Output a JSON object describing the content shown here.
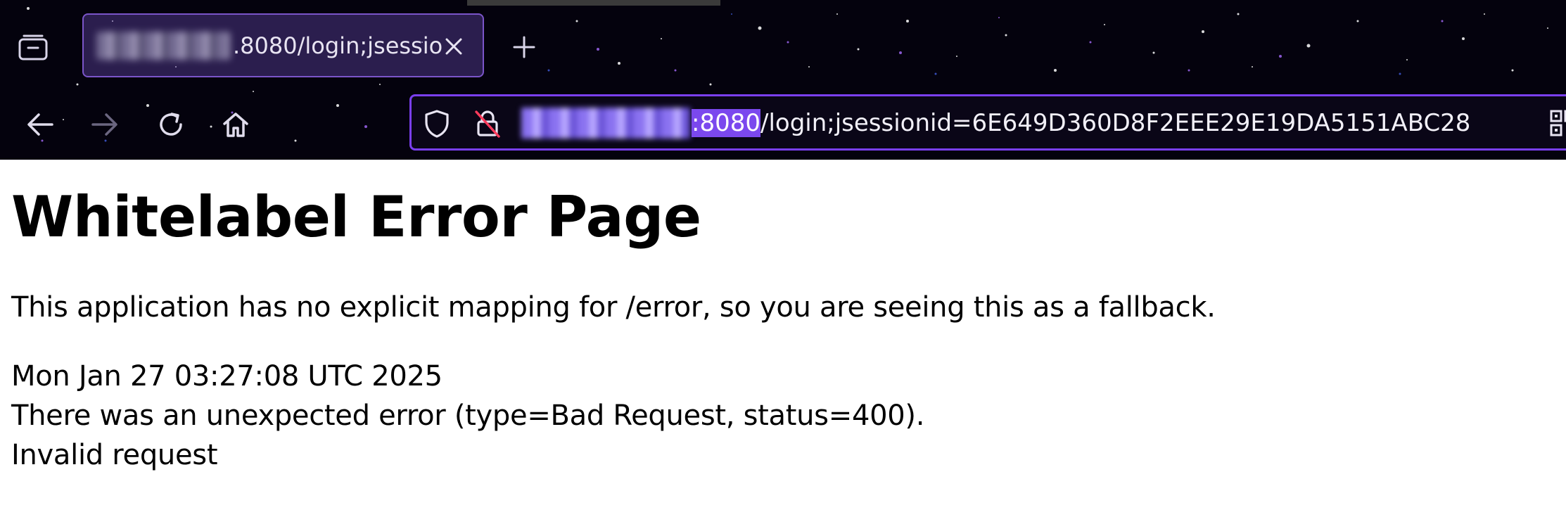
{
  "browser": {
    "tab": {
      "title": ".8080/login;jsessior",
      "close_icon": "close-icon"
    },
    "new_tab_icon": "plus-icon",
    "tab_list_icon": "tab-list-icon",
    "nav": {
      "back_icon": "arrow-left-icon",
      "forward_icon": "arrow-right-icon",
      "reload_icon": "reload-icon",
      "home_icon": "home-icon"
    },
    "url": {
      "port": ":8080",
      "path": "/login;jsessionid=6E649D360D8F2EEE29E19DA5151ABC28",
      "shield_icon": "shield-icon",
      "lock_icon": "insecure-lock-icon",
      "qr_icon": "qr-code-icon"
    },
    "accent_color": "#7a3ff0"
  },
  "page": {
    "title": "Whitelabel Error Page",
    "message": "This application has no explicit mapping for /error, so you are seeing this as a fallback.",
    "timestamp": "Mon Jan 27 03:27:08 UTC 2025",
    "error": "There was an unexpected error (type=Bad Request, status=400).",
    "detail": "Invalid request"
  }
}
